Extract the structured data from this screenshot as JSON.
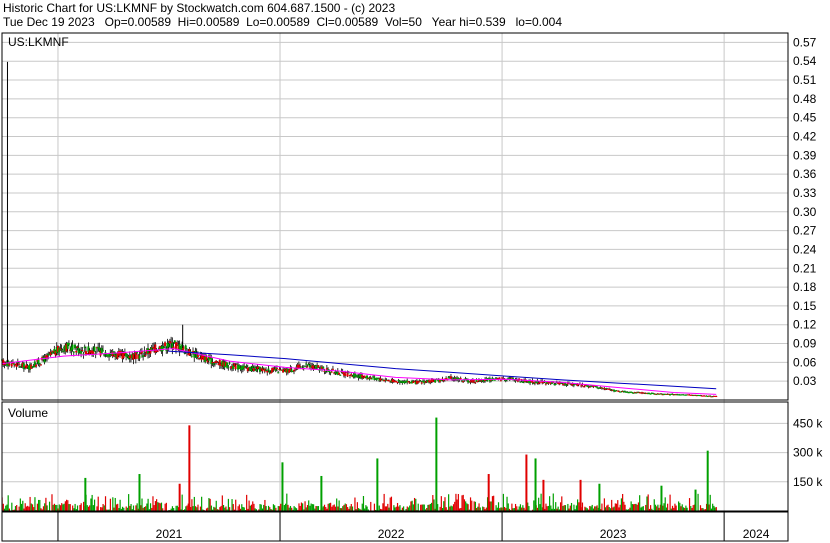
{
  "header": {
    "line1": "Historic Chart for US:LKMNF by Stockwatch.com 604.687.1500 - (c) 2023",
    "line2": "Tue Dec 19 2023   Op=0.00589  Hi=0.00589  Lo=0.00589  Cl=0.00589  Vol=50   Year hi=0.539   lo=0.004"
  },
  "chart_data": [
    {
      "type": "candlestick",
      "title": "US:LKMNF",
      "y_ticks": [
        "0.57",
        "0.54",
        "0.51",
        "0.48",
        "0.45",
        "0.42",
        "0.39",
        "0.36",
        "0.33",
        "0.30",
        "0.27",
        "0.24",
        "0.21",
        "0.18",
        "0.15",
        "0.12",
        "0.09",
        "0.06",
        "0.03"
      ],
      "ylim": [
        0.0,
        0.585
      ],
      "x_ticks": [
        "2021",
        "2022",
        "2023",
        "2024"
      ],
      "x_tick_dates": [
        "2021-01-01",
        "2022-01-01",
        "2023-01-01",
        "2024-01-01"
      ],
      "x_range": [
        "2020-10-01",
        "2024-04-15"
      ],
      "grid": true,
      "colors": {
        "up": "#00a000",
        "down": "#e00000",
        "ma_short": "#ff00ff",
        "ma_long": "#0000c0",
        "grid": "#c8c8c8"
      },
      "series": [
        {
          "kind": "price",
          "x": [
            "2020-10-01",
            "2020-10-20",
            "2020-11-15",
            "2020-12-10",
            "2021-01-10",
            "2021-02-10",
            "2021-03-10",
            "2021-04-10",
            "2021-05-10",
            "2021-06-10",
            "2021-07-10",
            "2021-08-10",
            "2021-09-10",
            "2021-10-10",
            "2021-11-10",
            "2021-12-10",
            "2022-01-10",
            "2022-02-10",
            "2022-03-10",
            "2022-04-10",
            "2022-05-10",
            "2022-06-10",
            "2022-07-10",
            "2022-08-10",
            "2022-09-10",
            "2022-10-10",
            "2022-11-10",
            "2022-12-10",
            "2023-01-10",
            "2023-02-10",
            "2023-03-10",
            "2023-04-10",
            "2023-05-10",
            "2023-06-10",
            "2023-07-10",
            "2023-08-10",
            "2023-09-10",
            "2023-10-10",
            "2023-11-10",
            "2023-12-19"
          ],
          "y": [
            0.06,
            0.058,
            0.052,
            0.065,
            0.085,
            0.08,
            0.078,
            0.072,
            0.07,
            0.082,
            0.09,
            0.075,
            0.062,
            0.055,
            0.05,
            0.048,
            0.046,
            0.055,
            0.05,
            0.043,
            0.038,
            0.034,
            0.03,
            0.028,
            0.03,
            0.035,
            0.03,
            0.032,
            0.035,
            0.03,
            0.028,
            0.026,
            0.024,
            0.02,
            0.014,
            0.012,
            0.01,
            0.009,
            0.008,
            0.00589
          ]
        },
        {
          "kind": "ma_short",
          "x": [
            "2020-10-01",
            "2021-01-10",
            "2021-04-10",
            "2021-07-10",
            "2021-10-10",
            "2022-01-10",
            "2022-04-10",
            "2022-07-10",
            "2022-10-10",
            "2023-01-10",
            "2023-04-10",
            "2023-07-10",
            "2023-10-10",
            "2023-12-19"
          ],
          "y": [
            0.058,
            0.07,
            0.075,
            0.082,
            0.062,
            0.052,
            0.046,
            0.036,
            0.032,
            0.033,
            0.028,
            0.02,
            0.012,
            0.009
          ]
        },
        {
          "kind": "ma_long",
          "x": [
            "2021-07-01",
            "2021-10-10",
            "2022-01-10",
            "2022-04-10",
            "2022-07-10",
            "2022-10-10",
            "2023-01-10",
            "2023-04-10",
            "2023-07-10",
            "2023-10-10",
            "2023-12-19"
          ],
          "y": [
            0.078,
            0.072,
            0.066,
            0.058,
            0.05,
            0.044,
            0.038,
            0.032,
            0.027,
            0.022,
            0.018
          ]
        }
      ],
      "notable_spikes": [
        {
          "x": "2020-10-10",
          "high": 0.539
        },
        {
          "x": "2021-07-25",
          "high": 0.12
        }
      ]
    },
    {
      "type": "bar",
      "title": "Volume",
      "y_ticks": [
        "450 k",
        "300 k",
        "150 k"
      ],
      "ylim": [
        0,
        560000
      ],
      "x_range": [
        "2020-10-01",
        "2024-04-15"
      ],
      "grid": true,
      "series": [
        {
          "name": "Volume",
          "x": [
            "2021-02-15",
            "2021-05-15",
            "2021-07-20",
            "2021-08-05",
            "2022-01-05",
            "2022-03-10",
            "2022-06-10",
            "2022-09-15",
            "2022-12-10",
            "2023-02-10",
            "2023-02-25",
            "2023-03-10",
            "2023-05-10",
            "2023-06-10",
            "2023-09-20",
            "2023-11-15",
            "2023-12-05"
          ],
          "y": [
            170000,
            190000,
            140000,
            440000,
            250000,
            180000,
            270000,
            480000,
            190000,
            290000,
            270000,
            160000,
            160000,
            140000,
            130000,
            110000,
            310000
          ],
          "up": [
            true,
            true,
            false,
            false,
            true,
            true,
            true,
            true,
            false,
            false,
            true,
            false,
            false,
            true,
            true,
            true,
            true
          ]
        }
      ]
    }
  ]
}
